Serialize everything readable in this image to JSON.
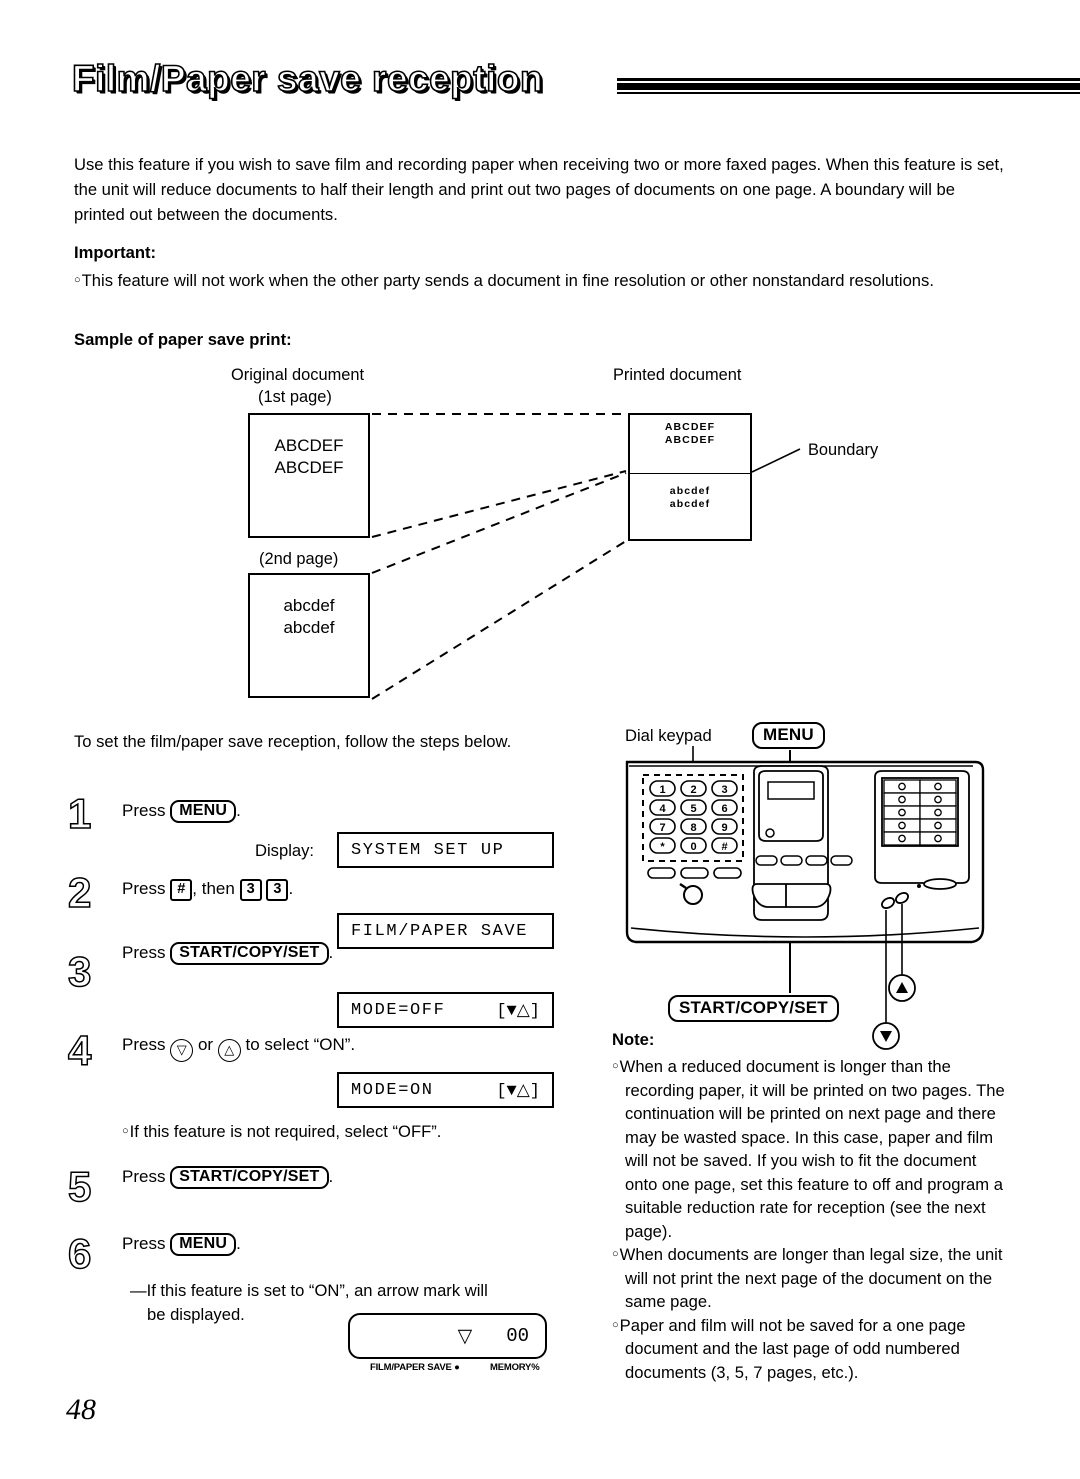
{
  "header": {
    "title": "Film/Paper save reception"
  },
  "intro": {
    "paragraph": "Use this feature if you wish to save film and recording paper when receiving two or more faxed pages. When this feature is set, the unit will reduce documents to half their length and print out two pages of documents on one page. A boundary will be printed out between the documents."
  },
  "important": {
    "heading": "Important:",
    "bullet": "This feature will not work when the other party sends a document in fine resolution or other nonstandard resolutions."
  },
  "sample": {
    "heading": "Sample of paper save print:",
    "original_label": "Original document",
    "first_page_label": "(1st page)",
    "second_page_label": "(2nd page)",
    "printed_label": "Printed document",
    "boundary_label": "Boundary",
    "original_page1_line1": "ABCDEF",
    "original_page1_line2": "ABCDEF",
    "original_page2_line1": "abcdef",
    "original_page2_line2": "abcdef",
    "printed_top_line1": "ABCDEF",
    "printed_top_line2": "ABCDEF",
    "printed_bottom_line1": "abcdef",
    "printed_bottom_line2": "abcdef"
  },
  "procedure": {
    "intro": "To set the film/paper save reception, follow the steps below.",
    "step1": {
      "number": "1",
      "press_word": "Press",
      "key": "MENU",
      "period": ".",
      "display_label": "Display:",
      "lcd": "SYSTEM SET UP"
    },
    "step2": {
      "number": "2",
      "press_word": "Press",
      "hash_key": "#",
      "then_word": ", then",
      "digit1": "3",
      "digit2": "3",
      "period": ".",
      "lcd": "FILM/PAPER SAVE"
    },
    "step3": {
      "number": "3",
      "press_word": "Press",
      "key": "START/COPY/SET",
      "period": ".",
      "lcd_left": "MODE=OFF",
      "lcd_right": "[▼△]"
    },
    "step4": {
      "number": "4",
      "press_word": "Press",
      "down_key": "▽",
      "or_word": "or",
      "up_key": "△",
      "tail": "to select “ON”.",
      "lcd_left": "MODE=ON",
      "lcd_right": "[▼△]",
      "bullet": "If this feature is not required, select “OFF”."
    },
    "step5": {
      "number": "5",
      "press_word": "Press",
      "key": "START/COPY/SET",
      "period": "."
    },
    "step6": {
      "number": "6",
      "press_word": "Press",
      "key": "MENU",
      "period": ".",
      "dash_note_line1": "—If this feature is set to “ON”, an arrow mark will",
      "dash_note_line2": "be displayed.",
      "lcd_arrow": "▽",
      "lcd_value": "00",
      "sublabel_left": "FILM/PAPER SAVE ●",
      "sublabel_right": "MEMORY%"
    }
  },
  "device": {
    "dial_keypad_label": "Dial keypad",
    "menu_label": "MENU",
    "start_copy_set_label": "START/COPY/SET",
    "keypad_keys": [
      "1",
      "2",
      "3",
      "4",
      "5",
      "6",
      "7",
      "8",
      "9",
      "*",
      "0",
      "#"
    ],
    "up_arrow": "△",
    "down_arrow": "▽"
  },
  "note": {
    "heading": "Note:",
    "bullets": [
      "When a reduced document is longer than the recording paper, it will be printed on two pages. The continuation will be printed on next page and there may be wasted space. In this case, paper and film will not be saved. If you wish to fit the document onto one page, set this feature to off and program a suitable reduction rate for reception (see the next page).",
      "When documents are longer than legal size, the unit will not print the next page of the document on the same page.",
      "Paper and film will not be saved for a one page document and the last page of odd numbered documents (3, 5, 7 pages, etc.)."
    ]
  },
  "footer": {
    "page_number": "48"
  }
}
